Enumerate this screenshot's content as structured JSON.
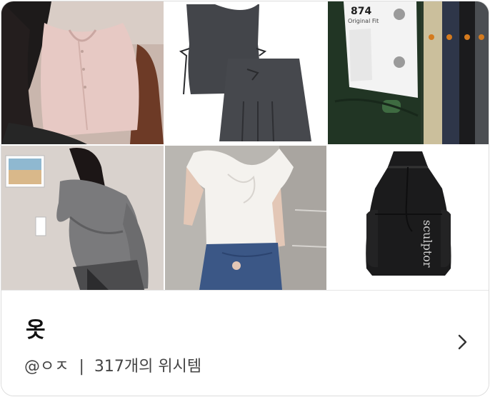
{
  "collection": {
    "title": "옷",
    "owner": "@ㅇㅈ",
    "separator": "|",
    "wish_count_text": "317개의 위시템"
  },
  "images": [
    {
      "name": "pink-knit-top-photo",
      "icon": "photo"
    },
    {
      "name": "gray-vest-skirt-set-photo",
      "icon": "photo"
    },
    {
      "name": "dickies-pants-tags-photo",
      "icon": "photo"
    },
    {
      "name": "gray-wrap-cardigan-photo",
      "icon": "photo"
    },
    {
      "name": "white-twist-tee-photo",
      "icon": "photo"
    },
    {
      "name": "sculptor-black-backpack-photo",
      "icon": "photo"
    }
  ],
  "product_text": {
    "pants_tag_number": "874",
    "pants_tag_sub": "Original Fit",
    "bag_brand": "sculptor"
  },
  "colors": {
    "title_text": "#111111",
    "meta_text": "#444444",
    "border": "#dcdcdc"
  }
}
